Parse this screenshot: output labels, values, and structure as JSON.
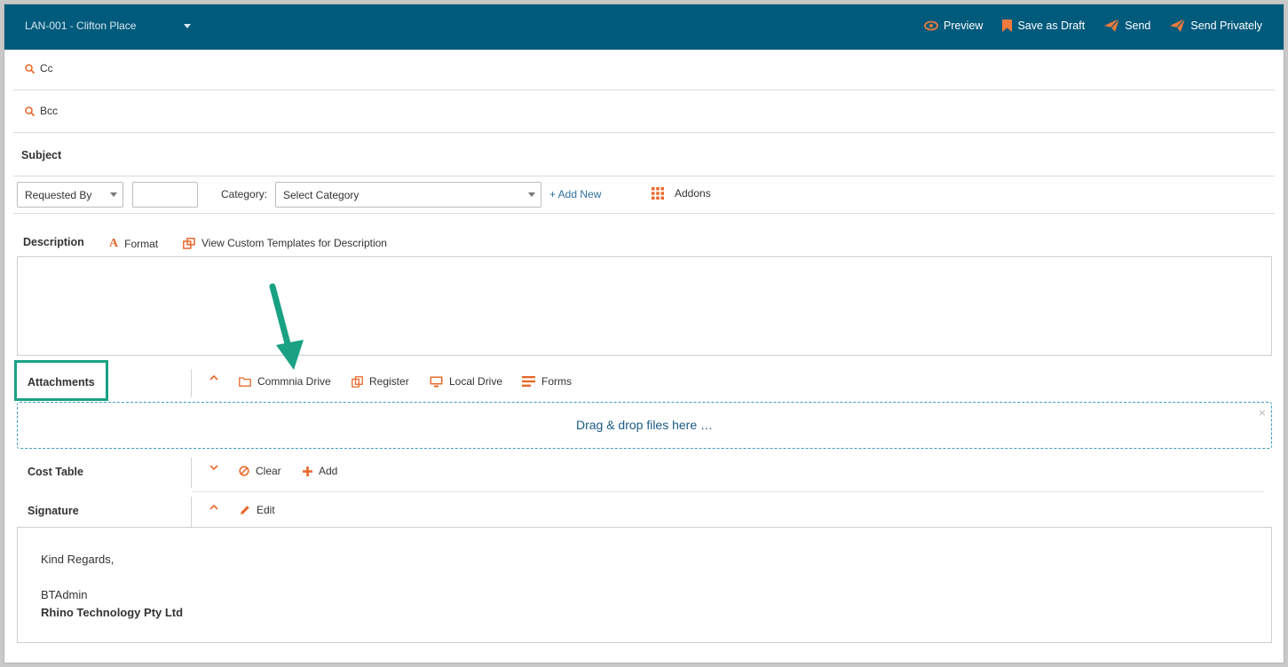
{
  "topbar": {
    "project": "LAN-001 - Clifton Place",
    "actions": [
      {
        "label": "Preview",
        "icon": "eye-icon"
      },
      {
        "label": "Save as Draft",
        "icon": "bookmark-icon"
      },
      {
        "label": "Send",
        "icon": "paper-plane-icon"
      },
      {
        "label": "Send Privately",
        "icon": "paper-plane-icon"
      }
    ]
  },
  "recipients": {
    "cc_label": "Cc",
    "bcc_label": "Bcc"
  },
  "subject": {
    "label": "Subject"
  },
  "fields": {
    "requested_by": "Requested By",
    "category_label": "Category:",
    "category_placeholder": "Select Category",
    "add_new": "+ Add New",
    "addons": "Addons"
  },
  "description": {
    "label": "Description",
    "format": "Format",
    "templates": "View Custom Templates for Description"
  },
  "attachments": {
    "label": "Attachments",
    "sources": [
      "Commnia Drive",
      "Register",
      "Local Drive",
      "Forms"
    ],
    "dropzone": "Drag & drop files here …",
    "close": "×"
  },
  "cost_table": {
    "label": "Cost Table",
    "clear": "Clear",
    "add": "Add"
  },
  "signature": {
    "label": "Signature",
    "edit": "Edit",
    "line1": "Kind Regards,",
    "name": "BTAdmin",
    "company": "Rhino Technology Pty Ltd"
  },
  "colors": {
    "topbar": "#005a7c",
    "accent": "#e8692c",
    "highlight": "#1aa184",
    "dropzone_border": "#3a9cc0"
  }
}
